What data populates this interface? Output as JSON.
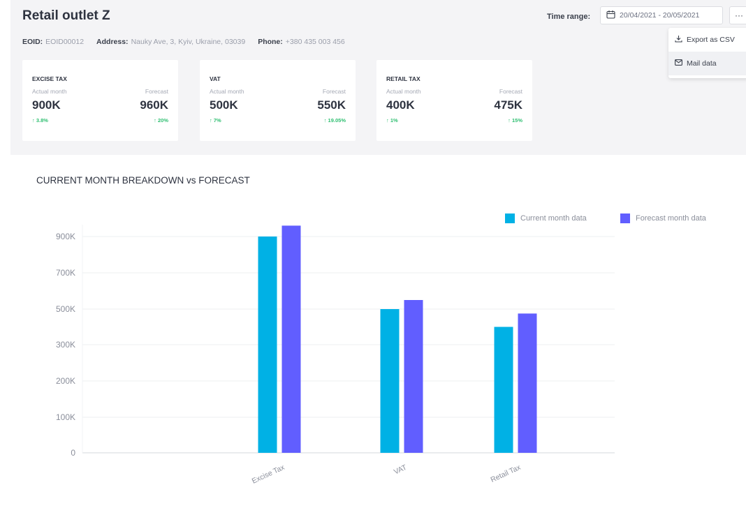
{
  "header": {
    "title": "Retail outlet Z",
    "eoid_label": "EOID:",
    "eoid_value": "EOID00012",
    "address_label": "Address:",
    "address_value": "Nauky Ave, 3, Kyiv, Ukraine, 03039",
    "phone_label": "Phone:",
    "phone_value": "+380 435 003 456"
  },
  "toolbar": {
    "time_range_label": "Time range:",
    "date_range": "20/04/2021 - 20/05/2021",
    "more_label": "···"
  },
  "menu": {
    "items": [
      {
        "label": "Export as CSV",
        "icon": "download-icon"
      },
      {
        "label": "Mail data",
        "icon": "mail-icon"
      }
    ]
  },
  "cards": [
    {
      "title": "EXCISE TAX",
      "actual_label": "Actual month",
      "forecast_label": "Forecast",
      "actual": "900K",
      "forecast": "960K",
      "actual_change": "↑ 3.8%",
      "forecast_change": "↑ 20%"
    },
    {
      "title": "VAT",
      "actual_label": "Actual month",
      "forecast_label": "Forecast",
      "actual": "500K",
      "forecast": "550K",
      "actual_change": "↑ 7%",
      "forecast_change": "↑ 19.05%"
    },
    {
      "title": "RETAIL TAX",
      "actual_label": "Actual month",
      "forecast_label": "Forecast",
      "actual": "400K",
      "forecast": "475K",
      "actual_change": "↑ 1%",
      "forecast_change": "↑ 15%"
    }
  ],
  "chart_data": {
    "type": "bar",
    "title": "CURRENT MONTH BREAKDOWN vs FORECAST",
    "categories": [
      "Excise Tax",
      "VAT",
      "Retail Tax"
    ],
    "series": [
      {
        "name": "Current month data",
        "color": "#00b1e5",
        "values": [
          900000,
          500000,
          400000
        ]
      },
      {
        "name": "Forecast month data",
        "color": "#615eff",
        "values": [
          960000,
          550000,
          475000
        ]
      }
    ],
    "y_ticks": [
      "0",
      "100K",
      "200K",
      "300K",
      "500K",
      "700K",
      "900K"
    ],
    "grid": true,
    "legend": "top-right"
  }
}
